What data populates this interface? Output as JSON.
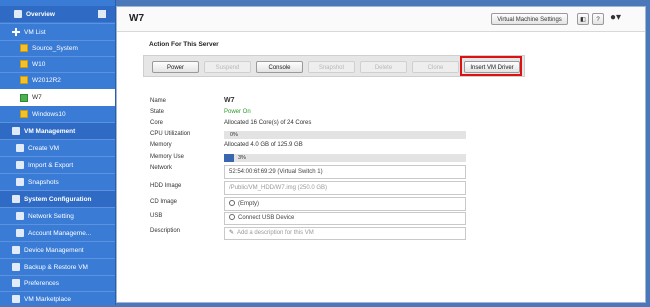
{
  "sidebar": {
    "items": [
      {
        "label": "Overview",
        "type": "head"
      },
      {
        "label": "VM List",
        "type": "sub"
      },
      {
        "label": "Source_System",
        "type": "vm",
        "icon": "yellow"
      },
      {
        "label": "W10",
        "type": "vm",
        "icon": "yellow"
      },
      {
        "label": "W2012R2",
        "type": "vm",
        "icon": "yellow"
      },
      {
        "label": "W7",
        "type": "vm",
        "icon": "green",
        "selected": true
      },
      {
        "label": "Windows10",
        "type": "vm",
        "icon": "yellow"
      },
      {
        "label": "VM Management",
        "type": "head"
      },
      {
        "label": "Create VM",
        "type": "sub"
      },
      {
        "label": "Import & Export",
        "type": "sub"
      },
      {
        "label": "Snapshots",
        "type": "sub"
      },
      {
        "label": "System Configuration",
        "type": "head"
      },
      {
        "label": "Network Setting",
        "type": "sub"
      },
      {
        "label": "Account Manageme...",
        "type": "sub"
      },
      {
        "label": "Device Management",
        "type": "head2"
      },
      {
        "label": "Backup & Restore VM",
        "type": "head2"
      },
      {
        "label": "Preferences",
        "type": "head2"
      },
      {
        "label": "VM Marketplace",
        "type": "head2"
      }
    ]
  },
  "header": {
    "title": "W7",
    "settings_button": "Virtual Machine Settings"
  },
  "actions": {
    "section_title": "Action For This Server",
    "buttons": [
      {
        "label": "Power",
        "enabled": true
      },
      {
        "label": "Suspend",
        "enabled": false
      },
      {
        "label": "Console",
        "enabled": true
      },
      {
        "label": "Snapshot",
        "enabled": false
      },
      {
        "label": "Delete",
        "enabled": false
      },
      {
        "label": "Clone",
        "enabled": false
      },
      {
        "label": "Insert VM Driver",
        "enabled": true
      }
    ]
  },
  "details": {
    "name_label": "Name",
    "name_value": "W7",
    "state_label": "State",
    "state_value": "Power On",
    "core_label": "Core",
    "core_value": "Allocated 16 Core(s) of 24 Cores",
    "cpu_label": "CPU Utilization",
    "cpu_value": "0%",
    "cpu_fraction": 0.0,
    "memory_label": "Memory",
    "memory_value": "Allocated 4.0 GB of 125.9 GB",
    "memuse_label": "Memory Use",
    "memuse_value": "3%",
    "memuse_fraction": 0.03,
    "network_label": "Network",
    "network_value": "52:54:00:6f:69:29 (Virtual Switch 1)",
    "hdd_label": "HDD Image",
    "hdd_value": "/Public/VM_HDD/W7.img (250.0 GB)",
    "cd_label": "CD Image",
    "cd_value": "(Empty)",
    "usb_label": "USB",
    "usb_value": "Connect USB Device",
    "desc_label": "Description",
    "desc_placeholder": "Add a description for this VM"
  },
  "colors": {
    "state_on": "#2e9a2e",
    "accent": "#3a7bd5",
    "highlight": "#dd1111"
  }
}
